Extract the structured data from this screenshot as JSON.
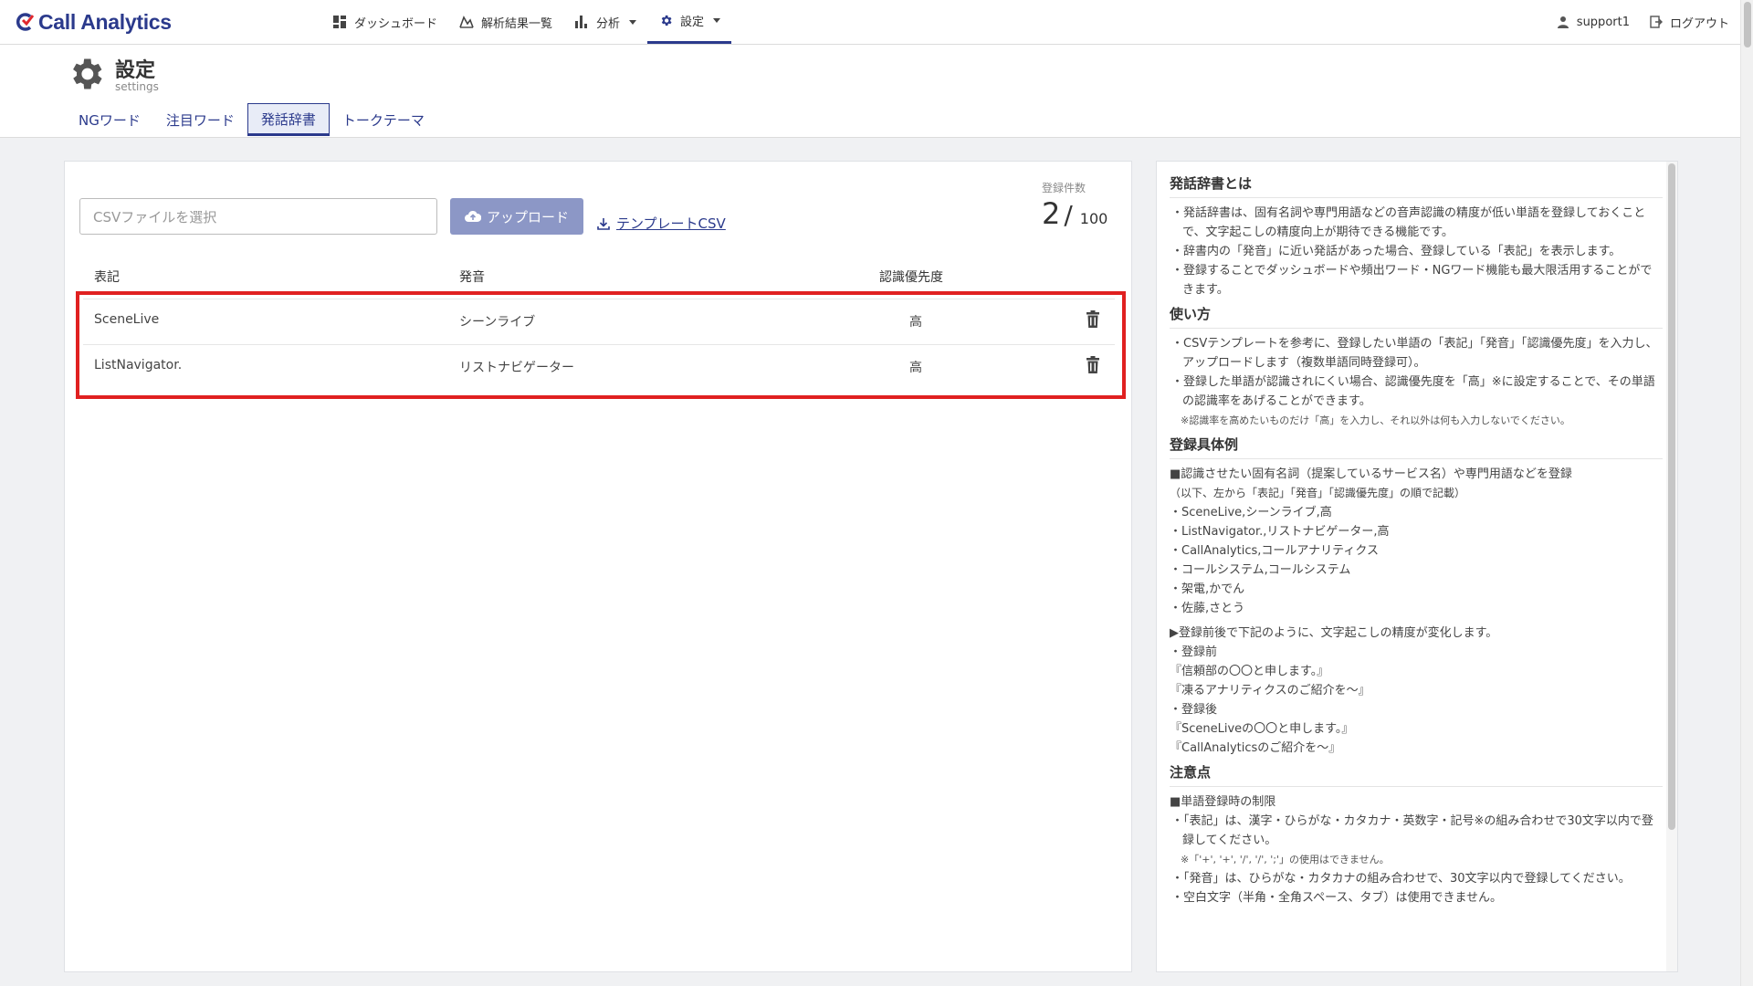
{
  "brand": {
    "name": "Call Analytics",
    "color": "#2b3a8c"
  },
  "nav": {
    "items": [
      {
        "label": "ダッシュボード",
        "icon": "dashboard-icon"
      },
      {
        "label": "解析結果一覧",
        "icon": "analysis-list-icon"
      },
      {
        "label": "分析",
        "icon": "bar-chart-icon"
      },
      {
        "label": "設定",
        "icon": "gear-icon"
      }
    ],
    "user": "support1",
    "logout": "ログアウト"
  },
  "header": {
    "title": "設定",
    "subtitle": "settings"
  },
  "tabs": [
    "NGワード",
    "注目ワード",
    "発話辞書",
    "トークテーマ"
  ],
  "upload": {
    "placeholder": "CSVファイルを選択",
    "button": "アップロード",
    "template_link": "テンプレートCSV"
  },
  "count": {
    "label": "登録件数",
    "value": "2",
    "sep": "/",
    "max": "100"
  },
  "table": {
    "headers": [
      "表記",
      "発音",
      "認識優先度"
    ],
    "rows": [
      {
        "notation": "SceneLive",
        "pronunciation": "シーンライブ",
        "priority": "高"
      },
      {
        "notation": "ListNavigator.",
        "pronunciation": "リストナビゲーター",
        "priority": "高"
      }
    ]
  },
  "side": {
    "h1": "発話辞書とは",
    "about": [
      "・発話辞書は、固有名詞や専門用語などの音声認識の精度が低い単語を登録しておくことで、文字起こしの精度向上が期待できる機能です。",
      "・辞書内の「発音」に近い発話があった場合、登録している「表記」を表示します。",
      "・登録することでダッシュボードや頻出ワード・NGワード機能も最大限活用することができます。"
    ],
    "h2": "使い方",
    "usage": [
      "・CSVテンプレートを参考に、登録したい単語の「表記」「発音」「認識優先度」を入力し、アップロードします（複数単語同時登録可）。",
      "・登録した単語が認識されにくい場合、認識優先度を「高」※に設定することで、その単語の認識率をあげることができます。"
    ],
    "usage_note": "※認識率を高めたいものだけ「高」を入力し、それ以外は何も入力しないでください。",
    "h3": "登録具体例",
    "example_intro": "■認識させたい固有名詞（提案しているサービス名）や専門用語などを登録",
    "example_sub": "（以下、左から「表記」「発音」「認識優先度」の順で記載）",
    "examples": [
      "・SceneLive,シーンライブ,高",
      "・ListNavigator.,リストナビゲーター,高",
      "・CallAnalytics,コールアナリティクス",
      "・コールシステム,コールシステム",
      "・架電,かでん",
      "・佐藤,さとう"
    ],
    "change_intro": "▶登録前後で下記のように、文字起こしの精度が変化します。",
    "before_label": "・登録前",
    "before": [
      "『信頼部の〇〇と申します。』",
      "『凍るアナリティクスのご紹介を～』"
    ],
    "after_label": "・登録後",
    "after": [
      "『SceneLiveの〇〇と申します。』",
      "『CallAnalyticsのご紹介を～』"
    ],
    "h4": "注意点",
    "limit_intro": "■単語登録時の制限",
    "limits": [
      "・「表記」は、漢字・ひらがな・カタカナ・英数字・記号※の組み合わせで30文字以内で登録してください。"
    ],
    "limit_note": "※「'+', '+', '/', '/', ';'」の使用はできません。",
    "limits2": [
      "・「発音」は、ひらがな・カタカナの組み合わせで、30文字以内で登録してください。",
      "・空白文字（半角・全角スペース、タブ）は使用できません。"
    ]
  }
}
